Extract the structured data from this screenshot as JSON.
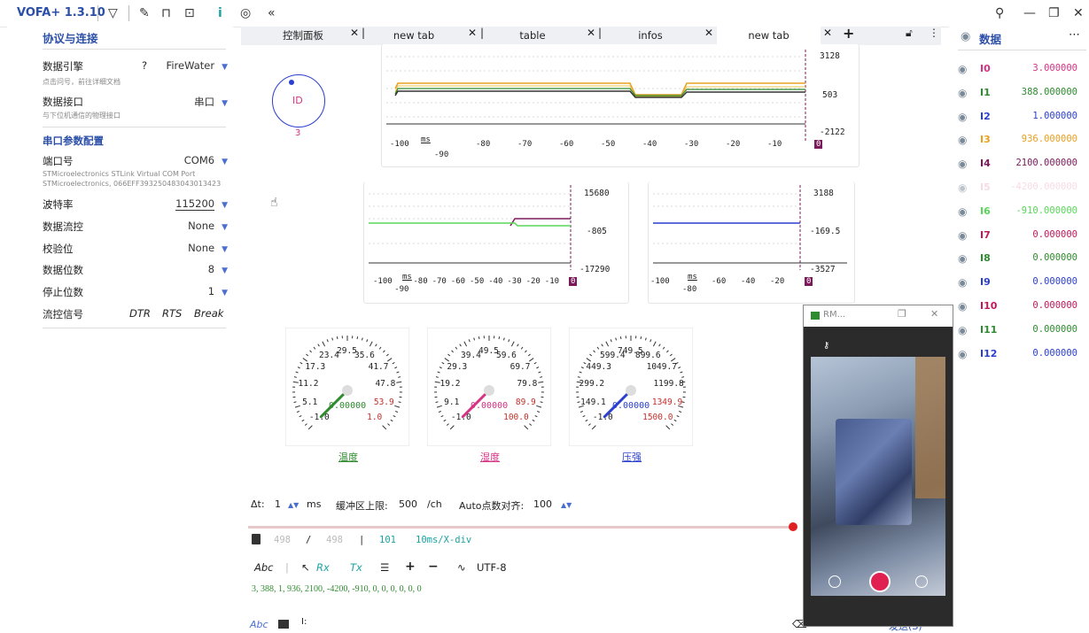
{
  "app": {
    "title": "VOFA+ 1.3.10"
  },
  "titlebar": {
    "icons": [
      "funnel-icon",
      "wrench-icon",
      "shirt-icon",
      "capture-icon",
      "info-icon",
      "fingerprint-icon",
      "collapse-icon"
    ],
    "right_icons": [
      "pin-icon",
      "minimize-icon",
      "restore-icon",
      "close-icon"
    ]
  },
  "sidebar_left": {
    "section_title": "协议与连接",
    "data_engine": {
      "label": "数据引擎",
      "help": "?",
      "value": "FireWater",
      "hint": "点击问号，前往详细文档"
    },
    "data_interface": {
      "label": "数据接口",
      "value": "串口",
      "hint": "与下位机通信的物理接口"
    },
    "serial_title": "串口参数配置",
    "port": {
      "label": "端口号",
      "value": "COM6",
      "desc1": "STMicroelectronics STLink Virtual COM Port",
      "desc2": "STMicroelectronics, 066EFF393250483043013423"
    },
    "baud": {
      "label": "波特率",
      "value": "115200"
    },
    "flow": {
      "label": "数据流控",
      "value": "None"
    },
    "parity": {
      "label": "校验位",
      "value": "None"
    },
    "databits": {
      "label": "数据位数",
      "value": "8"
    },
    "stopbits": {
      "label": "停止位数",
      "value": "1"
    },
    "flowsignal": {
      "label": "流控信号",
      "dtr": "DTR",
      "rts": "RTS",
      "brk": "Break"
    }
  },
  "tabs": [
    {
      "label": "控制面板"
    },
    {
      "label": "new tab"
    },
    {
      "label": "table"
    },
    {
      "label": "infos"
    },
    {
      "label": "new tab"
    }
  ],
  "tab_add": "+",
  "id_widget": {
    "label": "ID",
    "value": "3"
  },
  "charts": {
    "top": {
      "ymax": "3128",
      "ymid": "503",
      "ymin": "-2122",
      "ticks": [
        "-100",
        "-90",
        "-80",
        "-70",
        "-60",
        "-50",
        "-40",
        "-30",
        "-20",
        "-10",
        "0"
      ],
      "unit": "ms"
    },
    "mid_left": {
      "ymax": "15680",
      "ymid": "-805",
      "ymin": "-17290",
      "ticks": [
        "-100",
        "-90",
        "-80",
        "-70",
        "-60",
        "-50",
        "-40",
        "-30",
        "-20",
        "-10",
        "0"
      ],
      "unit": "ms"
    },
    "mid_right": {
      "ymax": "3188",
      "ymid": "-169.5",
      "ymin": "-3527",
      "ticks": [
        "-100",
        "-80",
        "-60",
        "-40",
        "-20",
        "0"
      ],
      "unit": "ms"
    }
  },
  "gauges": [
    {
      "name": "温度",
      "value": "0.00000",
      "labels": [
        "-1.0",
        "5.1",
        "11.2",
        "17.3",
        "23.4",
        "29.5",
        "35.6",
        "41.7",
        "47.8",
        "53.9",
        "1.0"
      ],
      "color": "#2e8b2e"
    },
    {
      "name": "湿度",
      "value": "0.00000",
      "labels": [
        "-1.0",
        "9.1",
        "19.2",
        "29.3",
        "39.4",
        "49.5",
        "59.6",
        "69.7",
        "79.8",
        "89.9",
        "100.0"
      ],
      "color": "#d63384"
    },
    {
      "name": "压强",
      "value": "0.00000",
      "labels": [
        "-1.0",
        "149.1",
        "299.2",
        "449.3",
        "599.4",
        "749.5",
        "899.6",
        "1049.7",
        "1199.8",
        "1349.9",
        "1500.0"
      ],
      "color": "#2b3fcf"
    }
  ],
  "controls": {
    "dt_label": "Δt:",
    "dt_value": "1",
    "dt_unit": "ms",
    "buffer_label": "缓冲区上限:",
    "buffer_value": "500",
    "buffer_unit": "/ch",
    "auto_label": "Auto点数对齐:",
    "auto_value": "100"
  },
  "status": {
    "count_a": "498",
    "slash": "/",
    "count_b": "498",
    "bar": "|",
    "count_c": "101",
    "scale": "10ms/X-div"
  },
  "toolbar": {
    "abc": "Abc",
    "rx": "Rx",
    "tx": "Tx",
    "encoding": "UTF-8",
    "plus": "+",
    "minus": "−"
  },
  "log": {
    "line": "3, 388, 1, 936, 2100, -4200, -910, 0, 0, 0, 0, 0, 0"
  },
  "input": {
    "abc": "Abc",
    "text": "I:",
    "send": "发送(S)"
  },
  "sidebar_right": {
    "title": "数据",
    "items": [
      {
        "name": "I0",
        "value": "3.000000",
        "color": "#d63384"
      },
      {
        "name": "I1",
        "value": "388.000000",
        "color": "#2e8b2e"
      },
      {
        "name": "I2",
        "value": "1.000000",
        "color": "#2b3fcf"
      },
      {
        "name": "I3",
        "value": "936.000000",
        "color": "#e8a020"
      },
      {
        "name": "I4",
        "value": "2100.000000",
        "color": "#7a1a5a"
      },
      {
        "name": "I5",
        "value": "-4200.000000",
        "color": "#f0b8c8"
      },
      {
        "name": "I6",
        "value": "-910.000000",
        "color": "#5ad65a"
      },
      {
        "name": "I7",
        "value": "0.000000",
        "color": "#c2185b"
      },
      {
        "name": "I8",
        "value": "0.000000",
        "color": "#2e8b2e"
      },
      {
        "name": "I9",
        "value": "0.000000",
        "color": "#2b3fcf"
      },
      {
        "name": "I10",
        "value": "0.000000",
        "color": "#c2185b"
      },
      {
        "name": "I11",
        "value": "0.000000",
        "color": "#2e8b2e"
      },
      {
        "name": "I12",
        "value": "0.000000",
        "color": "#2b3fcf"
      }
    ]
  },
  "rm_window": {
    "title": "RM..."
  }
}
